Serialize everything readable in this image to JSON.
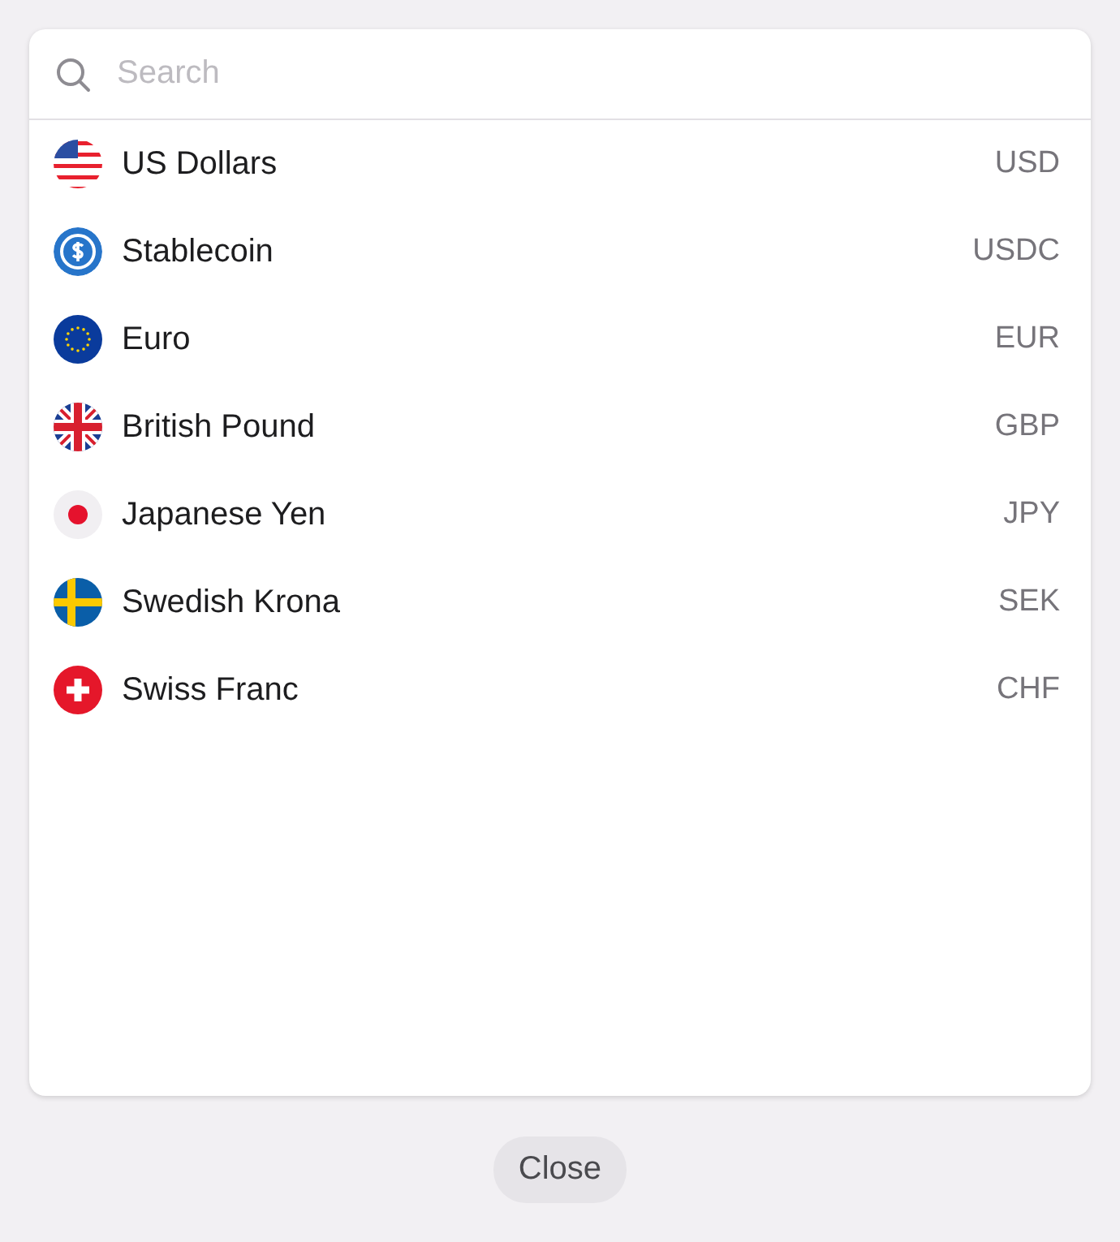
{
  "search": {
    "placeholder": "Search"
  },
  "currencies": [
    {
      "kind": "us",
      "name": "US Dollars",
      "code": "USD"
    },
    {
      "kind": "coin",
      "name": "Stablecoin",
      "code": "USDC"
    },
    {
      "kind": "eu",
      "name": "Euro",
      "code": "EUR"
    },
    {
      "kind": "gb",
      "name": "British Pound",
      "code": "GBP"
    },
    {
      "kind": "jp",
      "name": "Japanese Yen",
      "code": "JPY"
    },
    {
      "kind": "se",
      "name": "Swedish Krona",
      "code": "SEK"
    },
    {
      "kind": "ch",
      "name": "Swiss Franc",
      "code": "CHF"
    }
  ],
  "close_button": "Close"
}
